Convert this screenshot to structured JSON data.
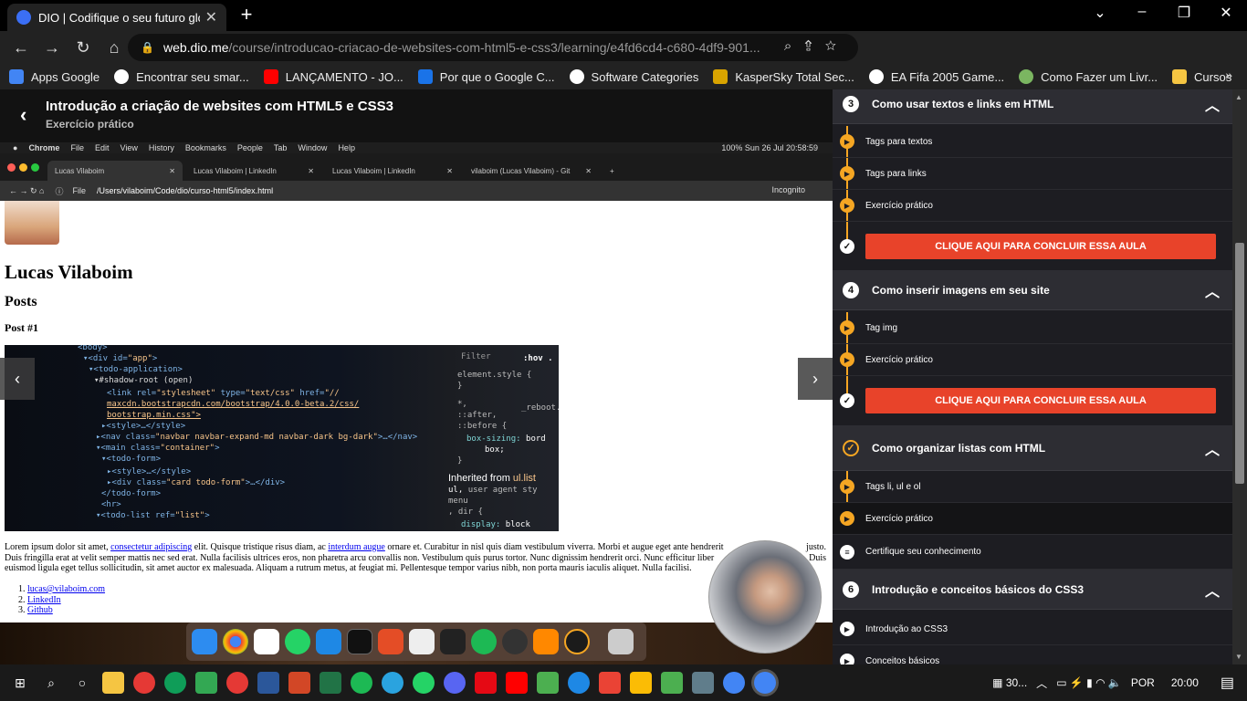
{
  "browser": {
    "tab_title": "DIO | Codifique o seu futuro glob",
    "url_domain": "web.dio.me",
    "url_path": "/course/introducao-criacao-de-websites-com-html5-e-css3/learning/e4fd6cd4-c680-4df9-901..."
  },
  "bookmarks": [
    {
      "label": "Apps Google",
      "color": "#4285f4"
    },
    {
      "label": "Encontrar seu smar...",
      "color": "#ffffff"
    },
    {
      "label": "LANÇAMENTO - JO...",
      "color": "#ff0000"
    },
    {
      "label": "Por que o Google C...",
      "color": "#1a73e8"
    },
    {
      "label": "Software Categories",
      "color": "#ffffff"
    },
    {
      "label": "KasperSky Total Sec...",
      "color": "#d9a400"
    },
    {
      "label": "EA Fifa 2005 Game...",
      "color": "#ffffff"
    },
    {
      "label": "Como Fazer um Livr...",
      "color": "#7bb661"
    },
    {
      "label": "Cursos",
      "color": "#f5c542"
    }
  ],
  "course": {
    "title": "Introdução a criação de websites com HTML5 e CSS3",
    "subtitle": "Exercício prático"
  },
  "video": {
    "mac_menu": [
      "Chrome",
      "File",
      "Edit",
      "View",
      "History",
      "Bookmarks",
      "People",
      "Tab",
      "Window",
      "Help"
    ],
    "mac_status": "100%   Sun 26 Jul  20:58:59",
    "inner_tabs": [
      "Lucas Vilaboim",
      "Lucas Vilaboim | LinkedIn",
      "Lucas Vilaboim | LinkedIn",
      "vilaboim (Lucas Vilaboim) - Git"
    ],
    "inner_file_label": "File",
    "inner_path": "/Users/vilaboim/Code/dio/curso-html5/index.html",
    "inner_incognito": "Incognito",
    "page": {
      "name": "Lucas Vilaboim",
      "posts_heading": "Posts",
      "post_title": "Post #1",
      "lorem_1": "Lorem ipsum dolor sit amet, ",
      "lorem_link_1": "consectetur adipiscing",
      "lorem_2": " elit. Quisque tristique risus diam, ac ",
      "lorem_link_2": "interdum augue",
      "lorem_3": " ornare et. Curabitur in nisl quis diam vestibulum viverra. Morbi et augue eget ante hendrerit",
      "lorem_4": "justo.",
      "lorem_5": "Duis fringilla erat at velit semper mattis nec sed erat. Nulla facilisis ultrices eros, non pharetra arcu convallis non. Vestibulum quis purus tortor. Nunc dignissim hendrerit orci. Nunc efficitur liber",
      "lorem_6": "Duis",
      "lorem_7": "euismod ligula eget tellus sollicitudin, sit amet auctor ex malesuada. Aliquam a rutrum metus, at feugiat mi. Pellentesque tempor varius nibh, non porta mauris iaculis aliquet. Nulla facilisi.",
      "links": [
        "lucas@vilaboim.com",
        "LinkedIn",
        "Github"
      ]
    }
  },
  "sidebar": {
    "sections": [
      {
        "num": "3",
        "title": "Como usar textos e links em HTML",
        "lessons": [
          "Tags para textos",
          "Tags para links",
          "Exercício prático"
        ],
        "cta": "CLIQUE AQUI PARA CONCLUIR ESSA AULA"
      },
      {
        "num": "4",
        "title": "Como inserir imagens em seu site",
        "lessons": [
          "Tag img",
          "Exercício prático"
        ],
        "cta": "CLIQUE AQUI PARA CONCLUIR ESSA AULA"
      },
      {
        "num": "",
        "title": "Como organizar listas com HTML",
        "lessons": [
          "Tags li, ul e ol",
          "Exercício prático",
          "Certifique seu conhecimento"
        ]
      },
      {
        "num": "6",
        "title": "Introdução e conceitos básicos do CSS3",
        "lessons": [
          "Introdução ao CSS3",
          "Conceitos básicos"
        ]
      }
    ]
  },
  "taskbar": {
    "weather": "30...",
    "lang": "POR",
    "time": "20:00"
  },
  "colors": {
    "accent": "#f5a623",
    "cta": "#e8432a"
  }
}
